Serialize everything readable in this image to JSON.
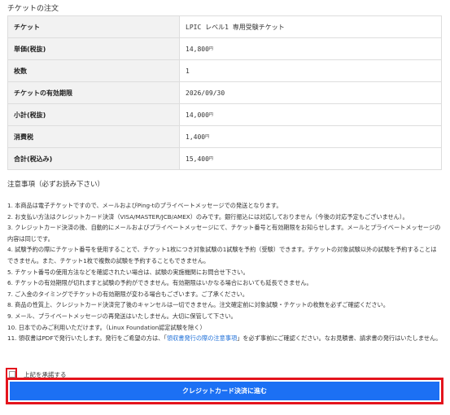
{
  "section_title": "チケットの注文",
  "order_rows": [
    {
      "label": "チケット",
      "value": "LPIC レベル1 専用受験チケット",
      "unit": ""
    },
    {
      "label": "単価(税抜)",
      "value": "14,800",
      "unit": "円"
    },
    {
      "label": "枚数",
      "value": "1",
      "unit": ""
    },
    {
      "label": "チケットの有効期限",
      "value": "2026/09/30",
      "unit": ""
    },
    {
      "label": "小計(税抜)",
      "value": "14,000",
      "unit": "円"
    },
    {
      "label": "消費税",
      "value": "1,400",
      "unit": "円"
    },
    {
      "label": "合計(税込み)",
      "value": "15,400",
      "unit": "円"
    }
  ],
  "notes_heading": "注意事項（必ずお読み下さい）",
  "notes": [
    "1. 本商品は電子チケットですので、メールおよびPing-tのプライベートメッセージでの発送となります。",
    "2. お支払い方法はクレジットカード決済（VISA/MASTER/JCB/AMEX）のみです。銀行振込には対応しておりません（今後の対応予定もございません）。",
    "3. クレジットカード決済の後、自動的にメールおよびプライベートメッセージにて、チケット番号と有効期限をお知らせします。メールとプライベートメッセージの内容は同じです。",
    "4. 試験予約の際にチケット番号を使用することで、チケット1枚につき対象試験の1試験を予約（受験）できます。チケットの対象試験以外の試験を予約することはできません。また、チケット1枚で複数の試験を予約することもできません。",
    "5. チケット番号の使用方法などを確認されたい場合は、試験の実施機関にお問合せ下さい。",
    "6. チケットの有効期限が切れますと試験の予約ができません。有効期限はいかなる場合においても延長できません。",
    "7. ご入金のタイミングでチケットの有効期限が変わる場合もございます。ご了承ください。",
    "8. 商品の性質上、クレジットカード決済完了後のキャンセルは一切できません。注文確定前に対象試験・チケットの枚数を必ずご確認ください。",
    "9. メール、プライベートメッセージの再発送はいたしません。大切に保管して下さい。",
    "10. 日本でのみご利用いただけます。（Linux Foundation認定試験を除く）"
  ],
  "note11": {
    "before": "11. 領収書はPDFで発行いたします。発行をご希望の方は、「",
    "link": "領収書発行の際の注意事項",
    "after": "」を必ず事前にご確認ください。なお見積書、請求書の発行はいたしません。"
  },
  "agree_label": "上記を承諾する",
  "submit_label": "クレジットカード決済に進む"
}
